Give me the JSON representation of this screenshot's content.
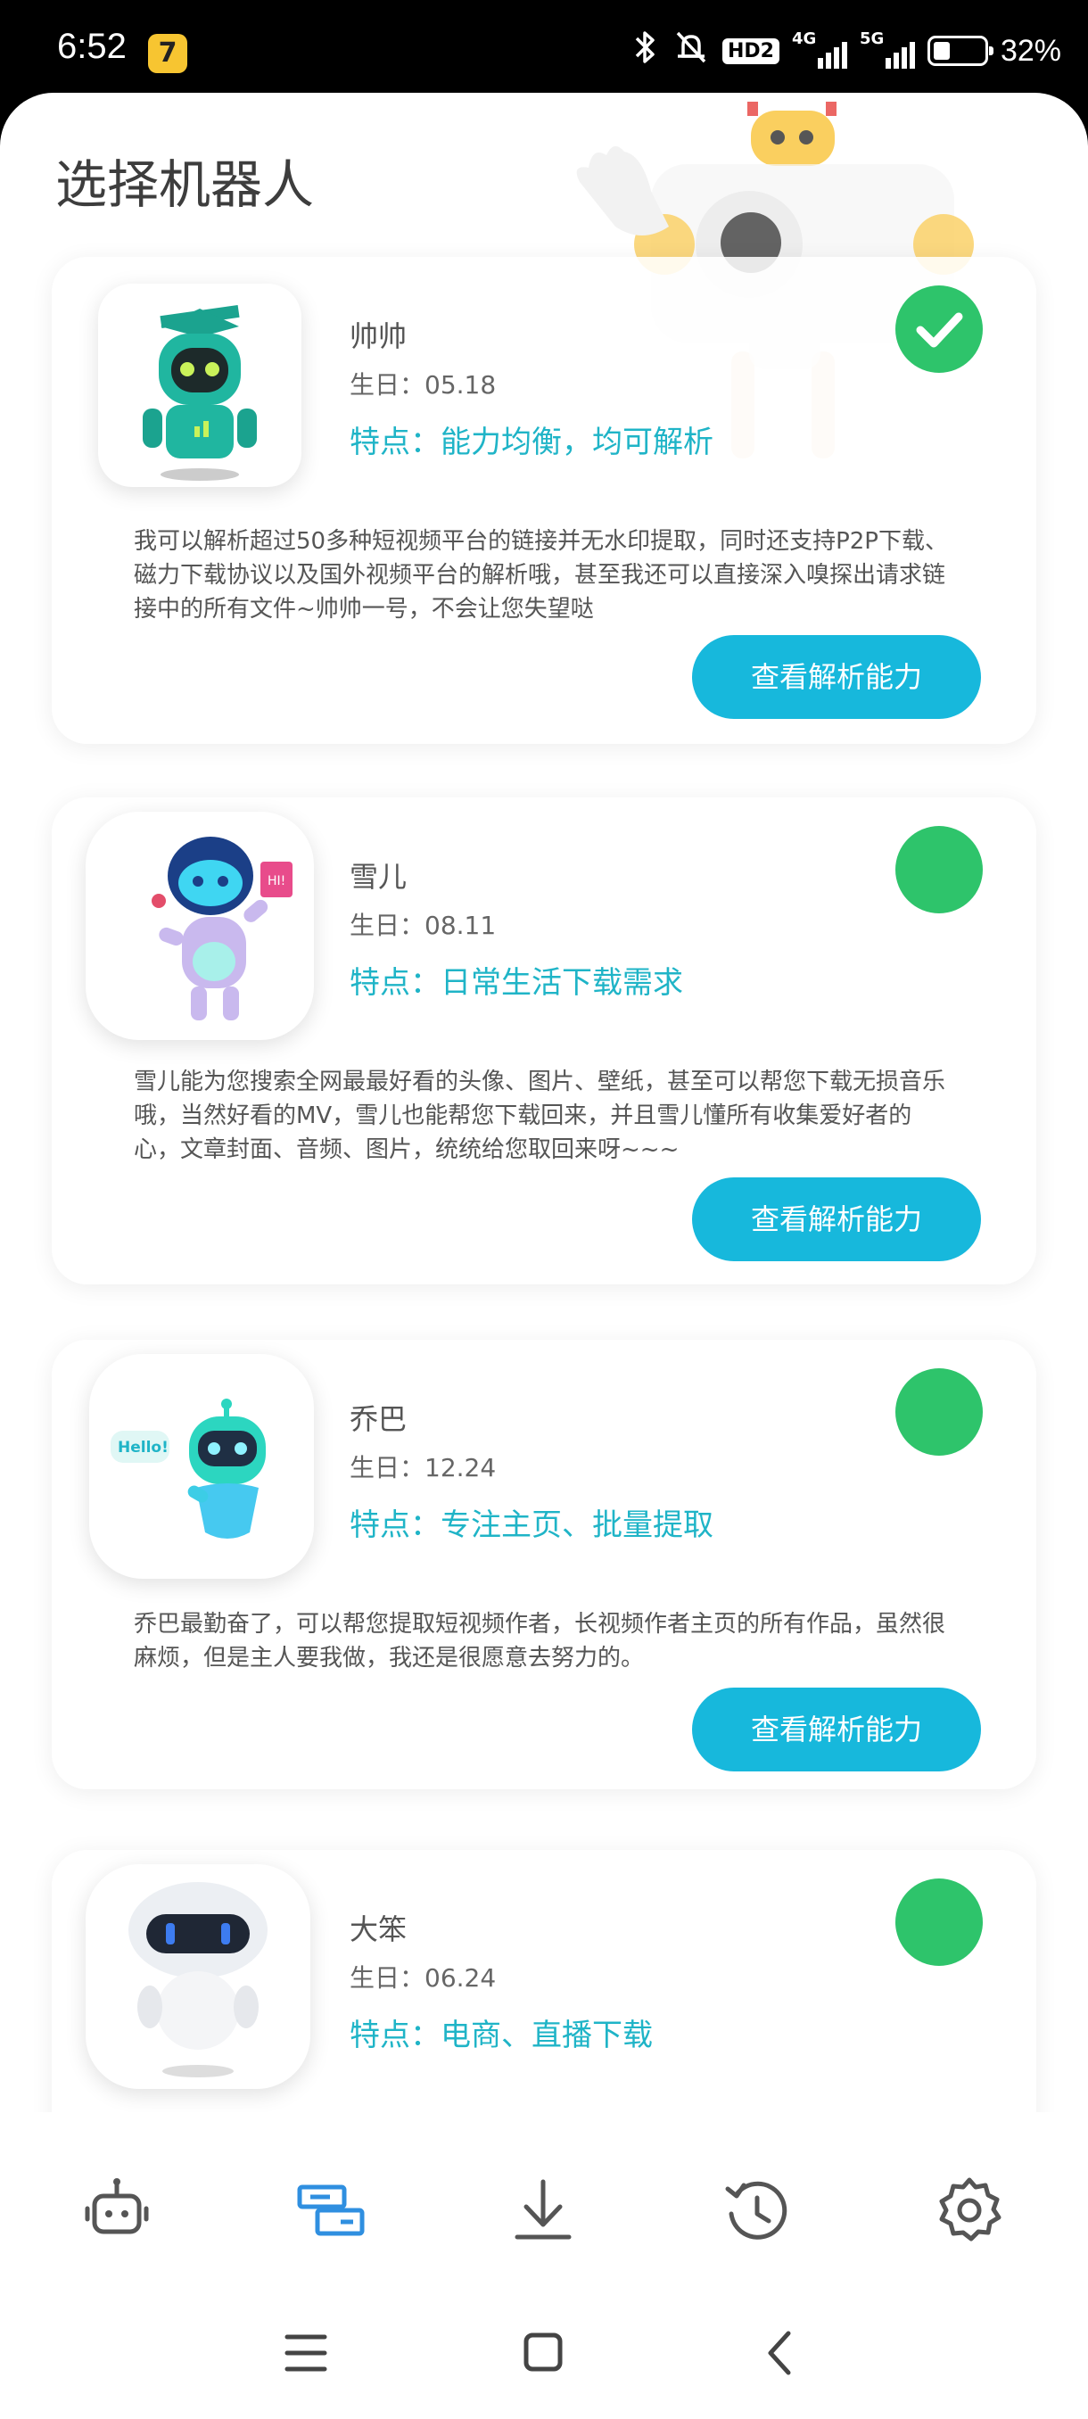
{
  "status_bar": {
    "time": "6:52",
    "app_icon_glyph": "7",
    "hd_badge": "HD2",
    "net1_label": "4G",
    "net2_label": "5G",
    "battery_percent": "32%",
    "battery_level": 0.32,
    "icons": [
      "bluetooth-icon",
      "silent-icon",
      "signal-icon",
      "battery-icon"
    ]
  },
  "page": {
    "title": "选择机器人"
  },
  "robots": [
    {
      "name": "帅帅",
      "birthday": "生日：05.18",
      "feature": "特点：能力均衡，均可解析",
      "description": "我可以解析超过50多种短视频平台的链接并无水印提取，同时还支持P2P下载、磁力下载协议以及国外视频平台的解析哦，甚至我还可以直接深入嗅探出请求链接中的所有文件~帅帅一号，不会让您失望哒",
      "button": "查看解析能力",
      "selected": true
    },
    {
      "name": "雪儿",
      "birthday": "生日：08.11",
      "feature": "特点：日常生活下载需求",
      "description": "雪儿能为您搜索全网最最好看的头像、图片、壁纸，甚至可以帮您下载无损音乐哦，当然好看的MV，雪儿也能帮您下载回来，并且雪儿懂所有收集爱好者的心，文章封面、音频、图片，统统给您取回来呀~~~",
      "button": "查看解析能力",
      "selected": false
    },
    {
      "name": "乔巴",
      "birthday": "生日：12.24",
      "feature": "特点：专注主页、批量提取",
      "description": "乔巴最勤奋了，可以帮您提取短视频作者，长视频作者主页的所有作品，虽然很麻烦，但是主人要我做，我还是很愿意去努力的。",
      "button": "查看解析能力",
      "selected": false,
      "avatar_text": "Hello!"
    },
    {
      "name": "大笨",
      "birthday": "生日：06.24",
      "feature": "特点：电商、直播下载",
      "selected": false
    }
  ],
  "tabs": [
    {
      "icon": "robot-icon",
      "active": false
    },
    {
      "icon": "parse-cards-icon",
      "active": true
    },
    {
      "icon": "download-icon",
      "active": false
    },
    {
      "icon": "history-icon",
      "active": false
    },
    {
      "icon": "settings-icon",
      "active": false
    }
  ],
  "nav": [
    "menu-icon",
    "home-icon",
    "back-icon"
  ],
  "colors": {
    "accent": "#17b8dc",
    "feature_text": "#1fb4c7",
    "selected_green": "#2ec46b",
    "tab_active": "#2f8fe0",
    "tab_inactive": "#555555"
  }
}
